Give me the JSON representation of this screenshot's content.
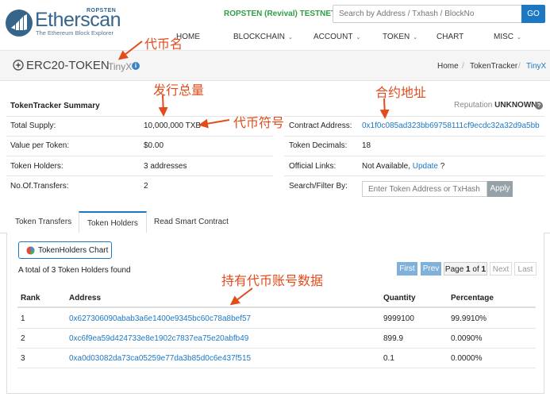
{
  "header": {
    "logo_text": "Etherscan",
    "logo_network": "ROPSTEN",
    "logo_subtitle": "The Ethereum Block Explorer",
    "network_label": "ROPSTEN (Revival) TESTNET",
    "search_placeholder": "Search by Address / Txhash / BlockNo",
    "go_label": "GO",
    "nav": [
      "HOME",
      "BLOCKCHAIN",
      "ACCOUNT",
      "TOKEN",
      "CHART",
      "MISC"
    ]
  },
  "titlebar": {
    "title": "ERC20-TOKEN",
    "token_name": "TinyX",
    "breadcrumbs": [
      "Home",
      "TokenTracker",
      "TinyX"
    ]
  },
  "summary": {
    "heading": "TokenTracker Summary",
    "reputation_label": "Reputation",
    "reputation_value": "UNKNOWN",
    "left": [
      {
        "label": "Total Supply:",
        "value": "10,000,000 TXB"
      },
      {
        "label": "Value per Token:",
        "value": "$0.00"
      },
      {
        "label": "Token Holders:",
        "value": "3 addresses"
      },
      {
        "label": "No.Of.Transfers:",
        "value": "2"
      }
    ],
    "right": {
      "contract_label": "Contract Address:",
      "contract_value": "0x1f0c085ad323bb69758111cf9ecdc32a32d9a5bb",
      "decimals_label": "Token Decimals:",
      "decimals_value": "18",
      "links_label": "Official Links:",
      "links_value": "Not Available,",
      "links_update": "Update",
      "links_q": "?",
      "filter_label": "Search/Filter By:",
      "filter_placeholder": "Enter Token Address or TxHash",
      "apply_label": "Apply"
    }
  },
  "tabs": [
    "Token Transfers",
    "Token Holders",
    "Read Smart Contract"
  ],
  "holders": {
    "chart_button": "TokenHolders Chart",
    "found_text": "A total of 3 Token Holders found",
    "pagination": {
      "first": "First",
      "prev": "Prev",
      "page": "Page",
      "current": "1",
      "of": "of",
      "total": "1",
      "next": "Next",
      "last": "Last"
    },
    "columns": [
      "Rank",
      "Address",
      "Quantity",
      "Percentage"
    ],
    "rows": [
      {
        "rank": "1",
        "address": "0x627306090abab3a6e1400e9345bc60c78a8bef57",
        "quantity": "9999100",
        "percentage": "99.9910%"
      },
      {
        "rank": "2",
        "address": "0xc6f9ea59d424733e8e1902c7837ea75e20abfb49",
        "quantity": "899.9",
        "percentage": "0.0090%"
      },
      {
        "rank": "3",
        "address": "0xa0d03082da73ca05259e77da3b85d0c6e437f515",
        "quantity": "0.1",
        "percentage": "0.0000%"
      }
    ]
  },
  "annotations": {
    "token_name": "代币名",
    "total_supply": "发行总量",
    "contract_address": "合约地址",
    "token_symbol": "代币符号",
    "holder_data": "持有代币账号数据"
  },
  "colors": {
    "accent": "#1d78c4",
    "network": "#2f9e44",
    "annotation": "#e34b1a"
  }
}
